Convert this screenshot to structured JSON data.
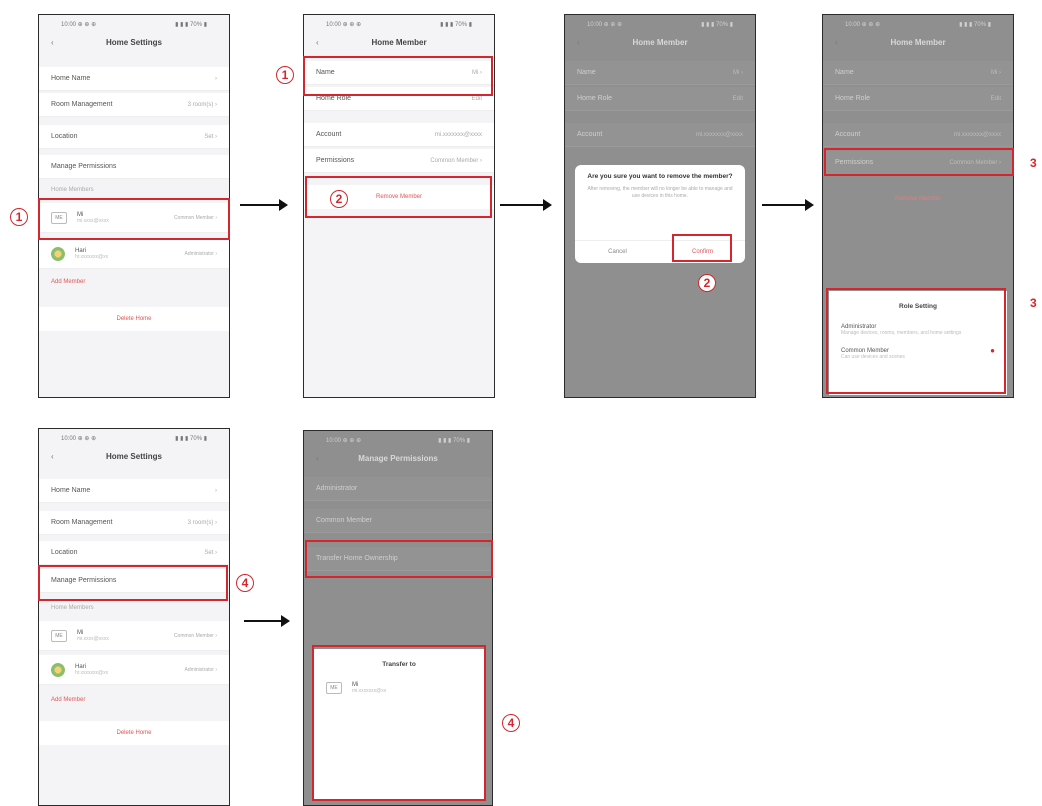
{
  "status": {
    "left": "10:00 ⊕ ⊕ ⊕",
    "right": "▮ ▮ ▮ 70% ▮"
  },
  "home_settings": {
    "title": "Home Settings",
    "back": "‹",
    "rows": [
      {
        "label": "Home Name",
        "value": "›"
      },
      {
        "label": "Room Management",
        "value": "3 room(s) ›"
      },
      {
        "label": "Location",
        "value": "Set ›"
      },
      {
        "label": "Manage Permissions",
        "value": ""
      }
    ],
    "members_header": "Home Members",
    "members": [
      {
        "avatar": "ME",
        "name": "Mi",
        "sub": "mi.xxxx@xxxx",
        "role": "Common Member ›"
      },
      {
        "avatar": "",
        "name": "Hari",
        "sub": "hr.xxxxxxx@xx",
        "role": "Administrator ›"
      }
    ],
    "add_member": "Add Member",
    "delete_home": "Delete Home"
  },
  "home_member": {
    "title": "Home Member",
    "rows": [
      {
        "label": "Name",
        "value": "Mi ›"
      },
      {
        "label": "Home Role",
        "value": "Edit"
      },
      {
        "label": "Account",
        "value": "mi.xxxxxxx@xxxx"
      },
      {
        "label": "Permissions",
        "value": "Common Member ›"
      }
    ],
    "remove": "Remove Member"
  },
  "confirm_dialog": {
    "title": "Are you sure you want to remove the member?",
    "message": "After removing, the member will no longer be able to manage and use devices in this home.",
    "cancel": "Cancel",
    "confirm": "Confirm"
  },
  "role_sheet": {
    "title": "Role Setting",
    "options": [
      {
        "name": "Administrator",
        "desc": "Manage devices, rooms, members, and home settings"
      },
      {
        "name": "Common Member",
        "desc": "Can use devices and scenes"
      }
    ],
    "selected_marker": "●"
  },
  "manage_permissions": {
    "title": "Manage Permissions",
    "rows": [
      {
        "label": "Administrator"
      },
      {
        "label": "Common Member"
      },
      {
        "label": "Transfer Home Ownership"
      }
    ]
  },
  "transfer_sheet": {
    "title": "Transfer to",
    "member": {
      "avatar": "ME",
      "name": "Mi",
      "sub": "mi.xxxxxxx@xx"
    }
  },
  "step_numbers": {
    "one": "1",
    "two": "2",
    "three": "3",
    "four": "4"
  },
  "colors": {
    "highlight": "#d3262e",
    "link_red": "#e05555",
    "arrow": "#111111"
  }
}
